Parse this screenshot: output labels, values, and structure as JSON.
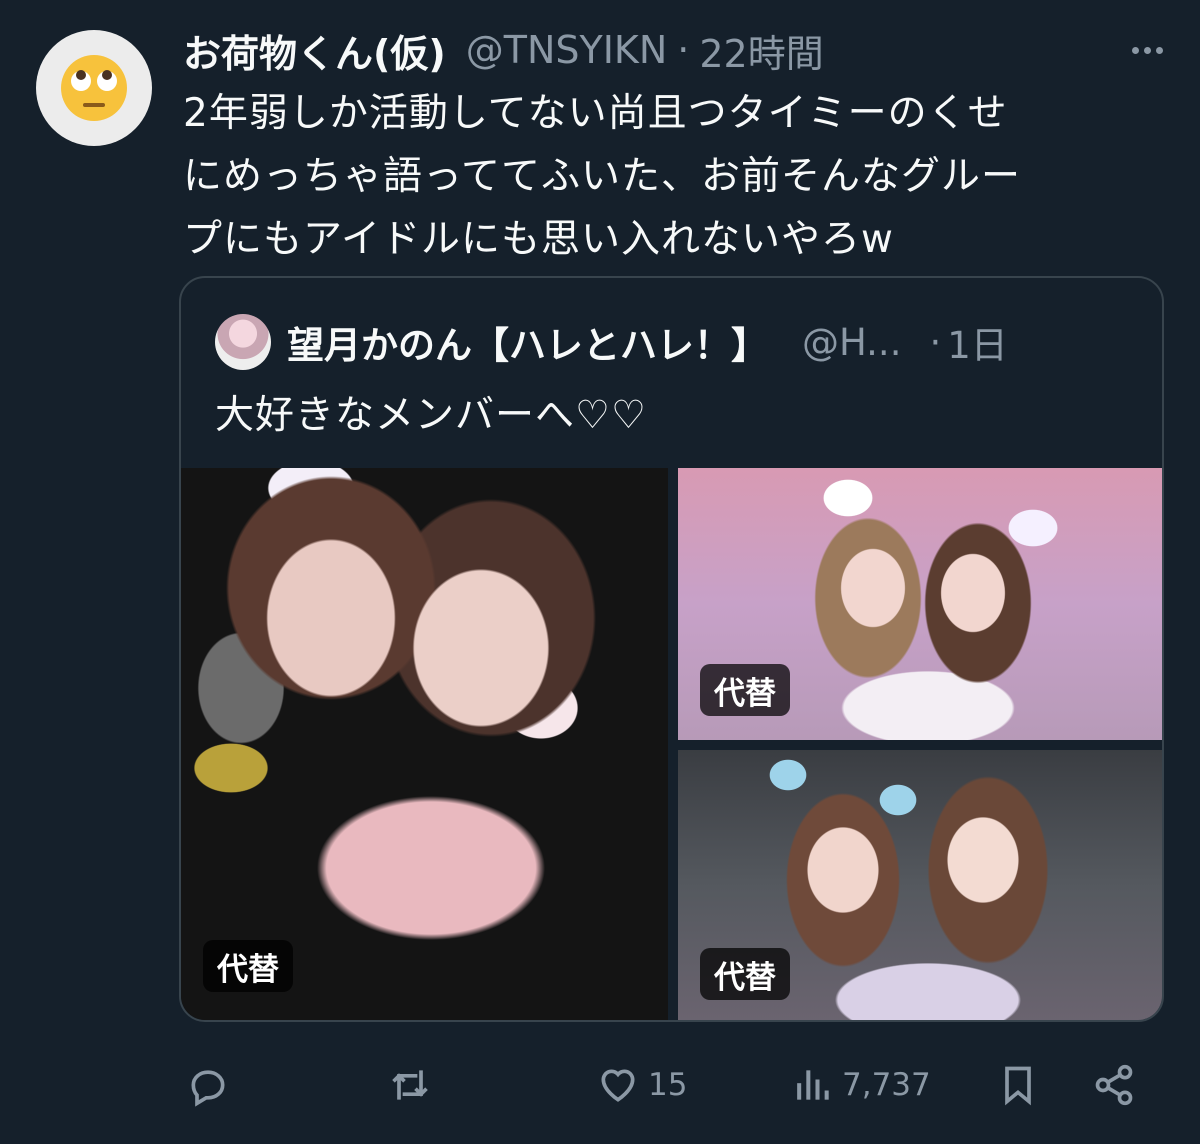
{
  "tweet": {
    "display_name": "お荷物くん(仮)",
    "handle": "@TNSYIKN",
    "separator": "·",
    "time": "22時間",
    "text_lines": [
      "2年弱しか活動してない尚且つタイミーのくせ",
      "にめっちゃ語っててふいた、お前そんなグルー",
      "プにもアイドルにも思い入れないやろw"
    ],
    "avatar_icon": "face-with-rolling-eyes-emoji"
  },
  "quote": {
    "display_name": "望月かのん【ハレとハレ！】",
    "handle": "@H...",
    "separator": "·",
    "time": "1日",
    "text": "大好きなメンバーへ♡♡",
    "media": [
      {
        "alt_label": "代替"
      },
      {
        "alt_label": "代替"
      },
      {
        "alt_label": "代替"
      }
    ]
  },
  "actions": {
    "reply": {
      "icon": "reply-icon",
      "count": ""
    },
    "retweet": {
      "icon": "retweet-icon",
      "count": ""
    },
    "like": {
      "icon": "heart-icon",
      "count": "15"
    },
    "views": {
      "icon": "views-icon",
      "count": "7,737"
    },
    "bookmark": {
      "icon": "bookmark-icon"
    },
    "share": {
      "icon": "share-icon"
    }
  },
  "colors": {
    "background": "#15202b",
    "text": "#f7f9f9",
    "secondary_text": "#8b98a5",
    "border": "#38444d"
  }
}
